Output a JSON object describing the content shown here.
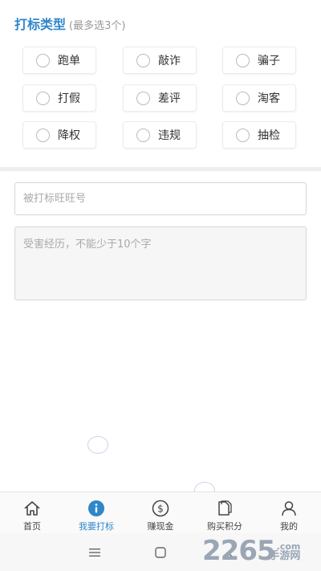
{
  "section": {
    "title": "打标类型",
    "hint": "(最多选3个)"
  },
  "options": [
    {
      "label": "跑单",
      "checked": false
    },
    {
      "label": "敲诈",
      "checked": false
    },
    {
      "label": "骗子",
      "checked": false
    },
    {
      "label": "打假",
      "checked": false
    },
    {
      "label": "差评",
      "checked": false
    },
    {
      "label": "淘客",
      "checked": false
    },
    {
      "label": "降权",
      "checked": false
    },
    {
      "label": "违规",
      "checked": false
    },
    {
      "label": "抽检",
      "checked": false
    }
  ],
  "form": {
    "wangwang_placeholder": "被打标旺旺号",
    "wangwang_value": "",
    "experience_placeholder": "受害经历，不能少于10个字",
    "experience_value": ""
  },
  "tabs": [
    {
      "label": "首页",
      "icon": "home-icon",
      "active": false
    },
    {
      "label": "我要打标",
      "icon": "info-icon",
      "active": true
    },
    {
      "label": "赚现金",
      "icon": "dollar-icon",
      "active": false
    },
    {
      "label": "购买积分",
      "icon": "document-icon",
      "active": false
    },
    {
      "label": "我的",
      "icon": "user-icon",
      "active": false
    }
  ],
  "system_nav": [
    "menu-icon",
    "home-square-icon",
    "back-icon"
  ],
  "watermark": {
    "big": "2265",
    "com": ".com",
    "small": "手游网"
  },
  "colors": {
    "accent": "#2f86c9",
    "hint": "#999999",
    "divider": "#eeeeee"
  }
}
